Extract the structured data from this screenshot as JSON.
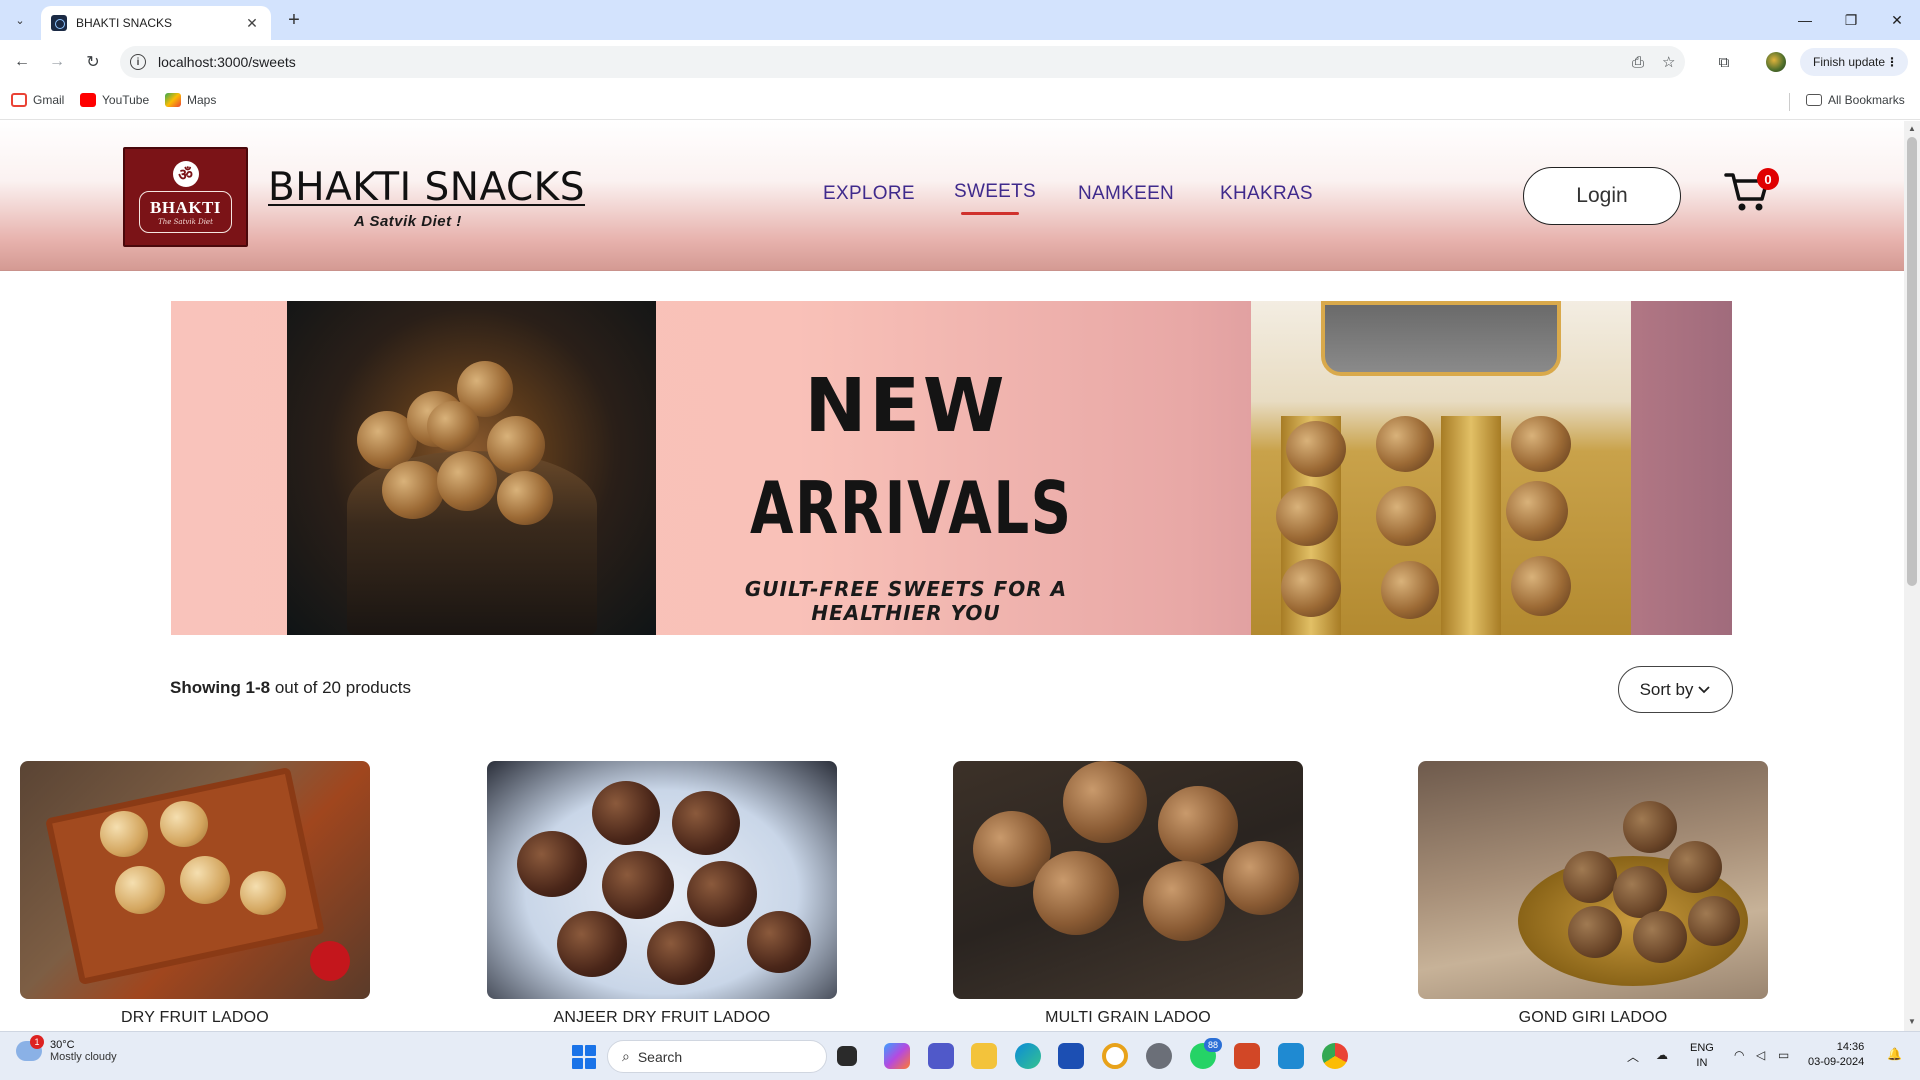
{
  "browser": {
    "tab_title": "BHAKTI SNACKS",
    "url": "localhost:3000/sweets",
    "finish_update": "Finish update",
    "bookmarks": [
      {
        "label": "Gmail",
        "color": "#ea4335"
      },
      {
        "label": "YouTube",
        "color": "#ff0000"
      },
      {
        "label": "Maps",
        "color": "#34a853"
      }
    ],
    "all_bookmarks": "All Bookmarks"
  },
  "site": {
    "logo_word": "BHAKTI",
    "logo_tag": "The Satvik Diet",
    "brand_name": "BHAKTI SNACKS",
    "tagline": "A Satvik Diet !",
    "nav": [
      {
        "label": "EXPLORE",
        "active": false
      },
      {
        "label": "SWEETS",
        "active": true
      },
      {
        "label": "NAMKEEN",
        "active": false
      },
      {
        "label": "KHAKRAS",
        "active": false
      }
    ],
    "login_label": "Login",
    "cart_count": "0",
    "colors": {
      "nav_text": "#3f2a8c",
      "active_underline": "#d0312d",
      "badge": "#e00000",
      "logo_bg": "#7b1317"
    }
  },
  "banner": {
    "line1": "NEW",
    "line2": "ARRIVALS",
    "subtitle": "GUILT-FREE SWEETS FOR A HEALTHIER YOU"
  },
  "results": {
    "range": "Showing 1-8",
    "rest": " out of 20 products",
    "sort_label": "Sort by"
  },
  "products": [
    {
      "name": "DRY FRUIT LADOO"
    },
    {
      "name": "ANJEER DRY FRUIT LADOO"
    },
    {
      "name": "MULTI GRAIN LADOO"
    },
    {
      "name": "GOND GIRI LADOO"
    }
  ],
  "taskbar": {
    "temp": "30°C",
    "weather": "Mostly cloudy",
    "weather_badge": "1",
    "search_placeholder": "Search",
    "whatsapp_badge": "88",
    "lang_1": "ENG",
    "lang_2": "IN",
    "time": "14:36",
    "date": "03-09-2024"
  }
}
